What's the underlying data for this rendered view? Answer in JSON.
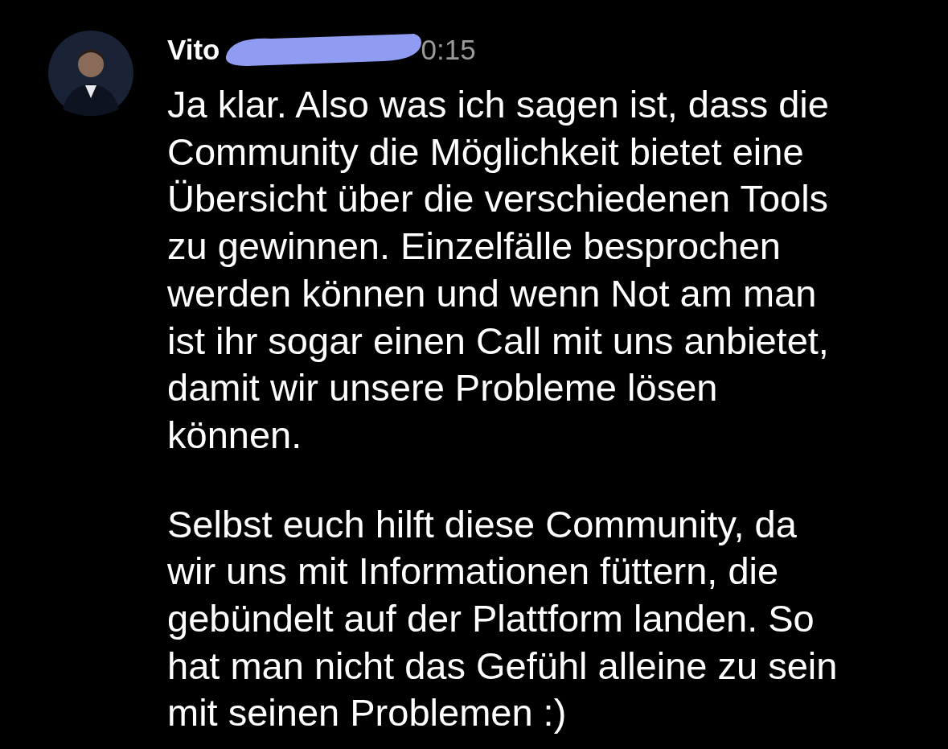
{
  "message": {
    "sender": "Vito",
    "time": "0:15",
    "redacted": true,
    "paragraphs": [
      [
        "Ja klar. Also was ich sagen ist, dass die",
        "Community die Möglichkeit bietet eine",
        "Übersicht über die verschiedenen Tools",
        "zu gewinnen. Einzelfälle besprochen",
        "werden können und wenn Not am man",
        "ist ihr sogar einen Call mit uns anbietet,",
        "damit wir unsere Probleme lösen",
        "können."
      ],
      [
        "Selbst euch hilft diese Community, da",
        "wir uns mit Informationen füttern, die",
        "gebündelt auf der Plattform landen. So",
        "hat man nicht das Gefühl alleine zu sein",
        "mit seinen Problemen :)"
      ]
    ]
  }
}
